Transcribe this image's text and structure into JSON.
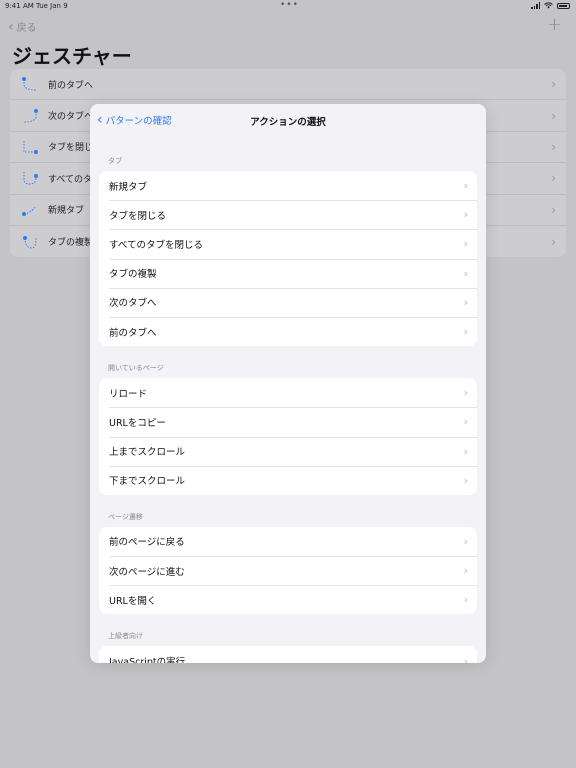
{
  "status": {
    "time": "9:41 AM",
    "date": "Tue Jan 9",
    "dots": "•••"
  },
  "background": {
    "back_label": "戻る",
    "plus": "+",
    "title": "ジェスチャー",
    "rows": [
      {
        "label": "前のタブへ"
      },
      {
        "label": "次のタブへ"
      },
      {
        "label": "タブを閉じ"
      },
      {
        "label": "すべてのタ"
      },
      {
        "label": "新規タブ"
      },
      {
        "label": "タブの複製"
      }
    ]
  },
  "sheet": {
    "back_label": "パターンの確認",
    "title": "アクションの選択",
    "sections": [
      {
        "header": "タブ",
        "items": [
          "新規タブ",
          "タブを閉じる",
          "すべてのタブを閉じる",
          "タブの複製",
          "次のタブへ",
          "前のタブへ"
        ]
      },
      {
        "header": "開いているページ",
        "items": [
          "リロード",
          "URLをコピー",
          "上までスクロール",
          "下までスクロール"
        ]
      },
      {
        "header": "ページ遷移",
        "items": [
          "前のページに戻る",
          "次のページに進む",
          "URLを開く"
        ]
      },
      {
        "header": "上級者向け",
        "items": [
          "JavaScriptの実行"
        ]
      }
    ]
  },
  "colors": {
    "accent": "#2f7cf6",
    "sheet_bg": "#f2f2f7",
    "dimmed_bg": "#c4c4c7"
  },
  "icons": {
    "chevron": "›",
    "back_chevron": "‹"
  }
}
